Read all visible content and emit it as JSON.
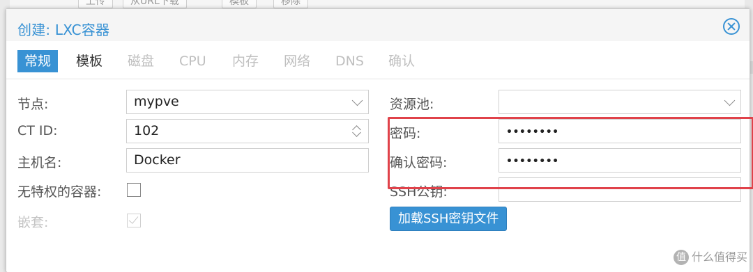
{
  "background": {
    "toolbar_buttons": [
      "上传",
      "从URL下载",
      "模板",
      "移除"
    ]
  },
  "dialog": {
    "title": "创建: LXC容器",
    "tabs": [
      {
        "label": "常规",
        "state": "active"
      },
      {
        "label": "模板",
        "state": "enabled"
      },
      {
        "label": "磁盘",
        "state": "disabled"
      },
      {
        "label": "CPU",
        "state": "disabled"
      },
      {
        "label": "内存",
        "state": "disabled"
      },
      {
        "label": "网络",
        "state": "disabled"
      },
      {
        "label": "DNS",
        "state": "disabled"
      },
      {
        "label": "确认",
        "state": "disabled"
      }
    ],
    "left": {
      "node_label": "节点:",
      "node_value": "mypve",
      "ctid_label": "CT ID:",
      "ctid_value": "102",
      "hostname_label": "主机名:",
      "hostname_value": "Docker",
      "unprivileged_label": "无特权的容器:",
      "nesting_label": "嵌套:"
    },
    "right": {
      "pool_label": "资源池:",
      "pool_value": "",
      "password_label": "密码:",
      "password_value": "••••••••",
      "confirm_password_label": "确认密码:",
      "confirm_password_value": "••••••••",
      "ssh_key_label": "SSH公钥:",
      "ssh_key_value": "",
      "load_ssh_button": "加载SSH密钥文件"
    }
  },
  "watermark": "什么值得买",
  "colors": {
    "accent": "#3892d4",
    "highlight": "#e0424a"
  }
}
